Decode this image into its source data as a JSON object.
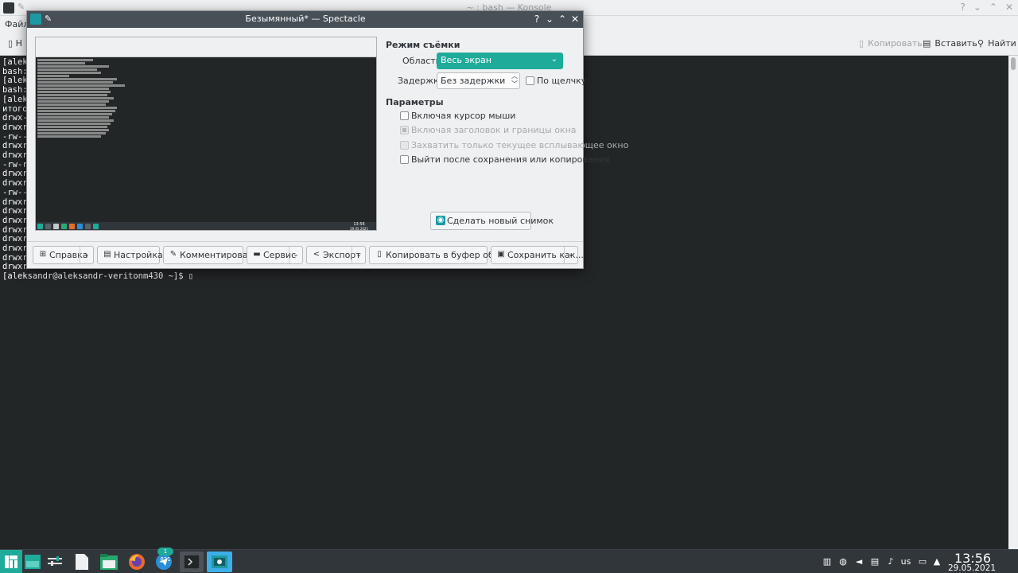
{
  "konsole": {
    "title": "~ : bash — Konsole",
    "menu_first": "Файл",
    "toolbar_new": "Н",
    "copy_label": "Копировать",
    "paste_label": "Вставить",
    "find_label": "Найти",
    "terminal_lines": [
      "[aleks",
      "bash:",
      "[aleks",
      "bash:",
      "[aleks",
      "итого",
      "drwx--",
      "drwxr-",
      "-rw---",
      "drwxr-",
      "drwxr-",
      "-rw-r-",
      "drwxr-",
      "drwxr-",
      "-rw---",
      "drwxr-",
      "drwxr-",
      "drwxr-",
      "drwxr-",
      "drwxr-",
      "drwxr-",
      "drwxr-",
      "drwxr-"
    ],
    "prompt_line": "[aleksandr@aleksandr-veritonm430 ~]$ ▯"
  },
  "spectacle": {
    "title": "Безымянный* — Spectacle",
    "capture_mode_heading": "Режим съёмки",
    "area_label": "Область:",
    "area_value": "Весь экран",
    "delay_label": "Задержка:",
    "delay_value": "Без задержки",
    "on_click_label": "По щелчку",
    "params_heading": "Параметры",
    "options": [
      {
        "label": "Включая курсор мыши",
        "enabled": true
      },
      {
        "label": "Включая заголовок и границы окна",
        "enabled": false
      },
      {
        "label": "Захватить только текущее всплывающее окно",
        "enabled": false
      },
      {
        "label": "Выйти после сохранения или копирования",
        "enabled": true
      }
    ],
    "new_screenshot_label": "Сделать новый снимок",
    "bottom_buttons": {
      "help": "Справка",
      "settings": "Настройка...",
      "annotate": "Комментировать",
      "tools": "Сервис",
      "export": "Экспорт",
      "copy_clipboard": "Копировать в буфер обмена",
      "save_as": "Сохранить как..."
    }
  },
  "preview": {
    "clock_time": "13:56",
    "clock_date": "29.05.2021"
  },
  "taskbar": {
    "badge": "1 821",
    "keyboard_layout": "us",
    "clock_time": "13:56",
    "clock_date": "29.05.2021",
    "colors": {
      "accent": "#1eab9a",
      "panel": "#31363b"
    }
  }
}
